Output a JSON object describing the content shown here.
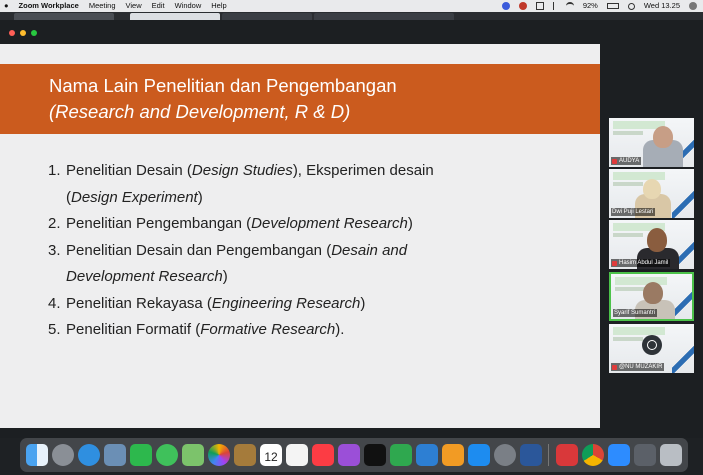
{
  "menubar": {
    "apple": "",
    "app": "Zoom Workplace",
    "menus": [
      "Meeting",
      "View",
      "Edit",
      "Window",
      "Help"
    ],
    "battery": "92%",
    "clock": "Wed 13.25"
  },
  "slide": {
    "title_line1": "Nama Lain Penelitian dan Pengembangan",
    "title_line2": "(Research and Development, R & D)",
    "items": [
      {
        "num": "1.",
        "parts": [
          "Penelitian Desain (",
          "Design Studies",
          "), Eksperimen desain"
        ],
        "cont": [
          "(",
          "Design Experiment",
          ")"
        ]
      },
      {
        "num": "2.",
        "parts": [
          "Penelitian Pengembangan (",
          "Development Research",
          ")"
        ]
      },
      {
        "num": "3.",
        "parts": [
          "Penelitian Desain dan Pengembangan (",
          "Desain and",
          ""
        ],
        "cont": [
          "",
          "Development Research",
          ")"
        ]
      },
      {
        "num": "4.",
        "parts": [
          "Penelitian Rekayasa (",
          "Engineering Research",
          ")"
        ]
      },
      {
        "num": "5.",
        "parts": [
          "Penelitian Formatif (",
          "Formative Research",
          ")."
        ]
      }
    ]
  },
  "participants": [
    {
      "name": "AUDYA",
      "muted": true
    },
    {
      "name": "Dwi Puji Lestari",
      "muted": false
    },
    {
      "name": "Hasim Abdul Jamil",
      "muted": true
    },
    {
      "name": "Syarif Sumantri",
      "muted": false,
      "active": true
    },
    {
      "name": "@NU MUZAKIR",
      "muted": true
    }
  ],
  "colors": {
    "slide_header": "#cb5b1e",
    "slide_bg": "#eeeeef",
    "active_speaker": "#4cc24a"
  },
  "dock": {
    "calendar_day": "12"
  }
}
